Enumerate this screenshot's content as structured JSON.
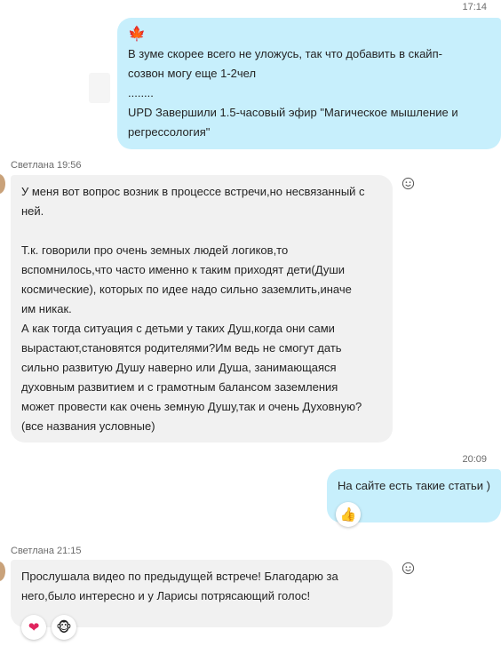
{
  "messages": [
    {
      "time": "17:14",
      "emoji": "🍁",
      "lines": [
        "В зуме скорее всего не уложусь, так что добавить в скайп-",
        "созвон могу еще 1-2чел",
        "........",
        "UPD Завершили 1.5-часовый эфир \"Магическое мышление и",
        "регрессология\""
      ]
    },
    {
      "sender": "Светлана 19:56",
      "lines": [
        "У меня вот вопрос возник в процессе встречи,но несвязанный с",
        "ней.",
        "",
        "Т.к. говорили про очень земных людей логиков,то",
        "вспомнилось,что часто именно к таким приходят дети(Души",
        "космические), которых по идее надо сильно заземлить,иначе",
        "им никак.",
        "А как тогда ситуация с детьми у таких Душ,когда они сами",
        "вырастают,становятся родителями?Им ведь не смогут дать",
        "сильно развитую Душу наверно или Душа, занимающаяся",
        "духовным развитием и с грамотным балансом заземления",
        "может провести как очень земную Душу,так и очень Духовную?",
        "(все названия условные)"
      ]
    },
    {
      "time": "20:09",
      "text": "На сайте есть такие статьи )",
      "reaction": "👍"
    },
    {
      "sender": "Светлана 21:15",
      "lines": [
        "Прослушала видео по предыдущей встрече! Благодарю за",
        "него,было интересно и у Ларисы потрясающий голос!"
      ],
      "reactions": [
        "❤",
        "🐵"
      ]
    }
  ],
  "colors": {
    "outgoing_bubble": "#c7effc",
    "incoming_bubble": "#f1f1f1",
    "timestamp": "#6b6b6b",
    "heart": "#e0245e",
    "maple_leaf": "#d9382a"
  },
  "icons": {
    "add_reaction": "smiley-face-icon"
  }
}
